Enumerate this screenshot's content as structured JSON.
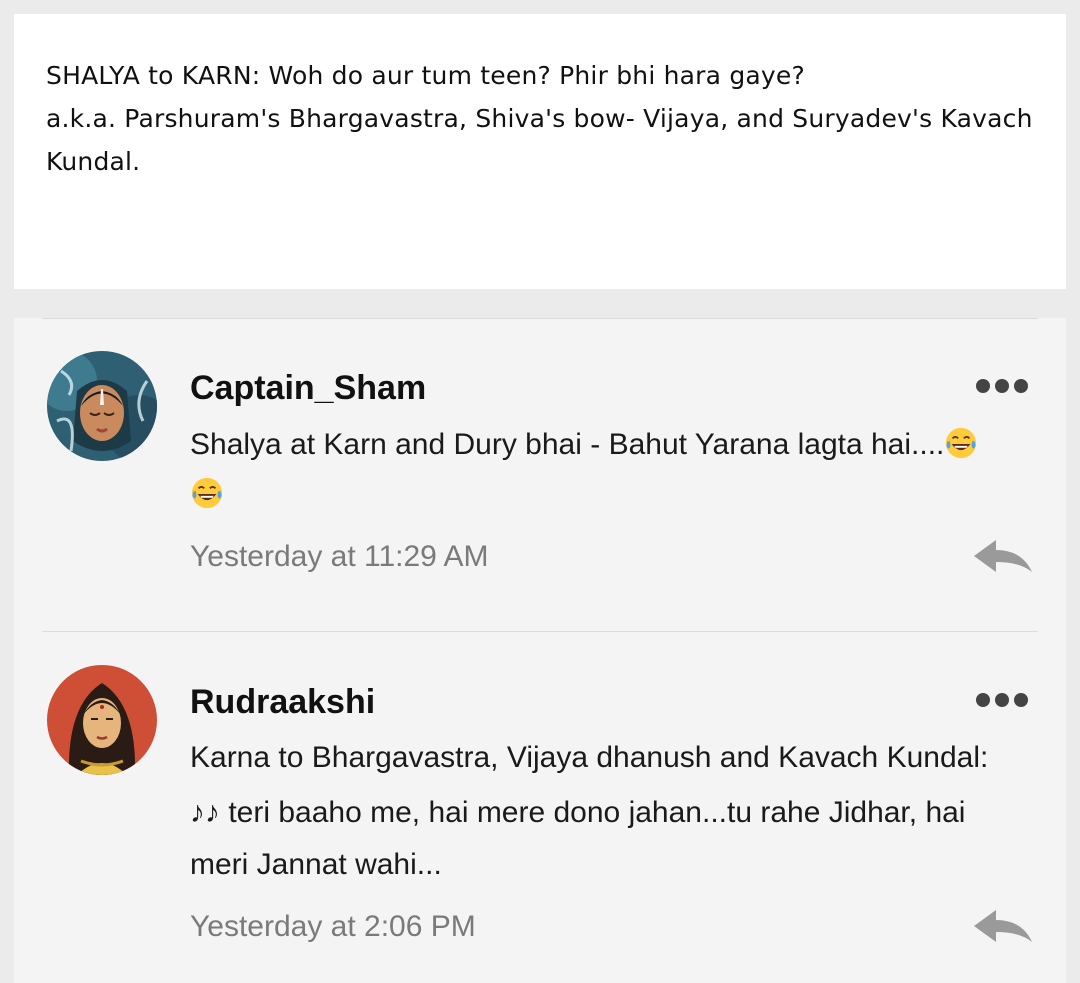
{
  "post": {
    "lines": [
      "SHALYA to KARN: Woh do aur tum teen? Phir bhi hara gaye?",
      "a.k.a. Parshuram's Bhargavastra, Shiva's bow- Vijaya, and Suryadev's Kavach",
      "Kundal."
    ]
  },
  "comments": [
    {
      "author": "Captain_Sham",
      "line1": "Shalya at Karn and Dury bhai - Bahut Yarana lagta hai....",
      "emoji": "tears-of-joy-emoji",
      "timestamp": "Yesterday at 11:29 AM"
    },
    {
      "author": "Rudraakshi",
      "line1": "Karna to Bhargavastra, Vijaya dhanush and Kavach Kundal:",
      "line2": "♪♪ teri baaho me, hai mere dono jahan...tu rahe Jidhar, hai",
      "line3": "meri Jannat wahi...",
      "timestamp": "Yesterday at 2:06 PM"
    }
  ],
  "icons": {
    "more": "more-options-icon",
    "reply": "reply-icon"
  },
  "colors": {
    "panel_background": "#f4f4f4",
    "page_background": "#ebebeb",
    "timestamp": "#7a7a7a",
    "reply_icon": "#9a9a9a"
  }
}
